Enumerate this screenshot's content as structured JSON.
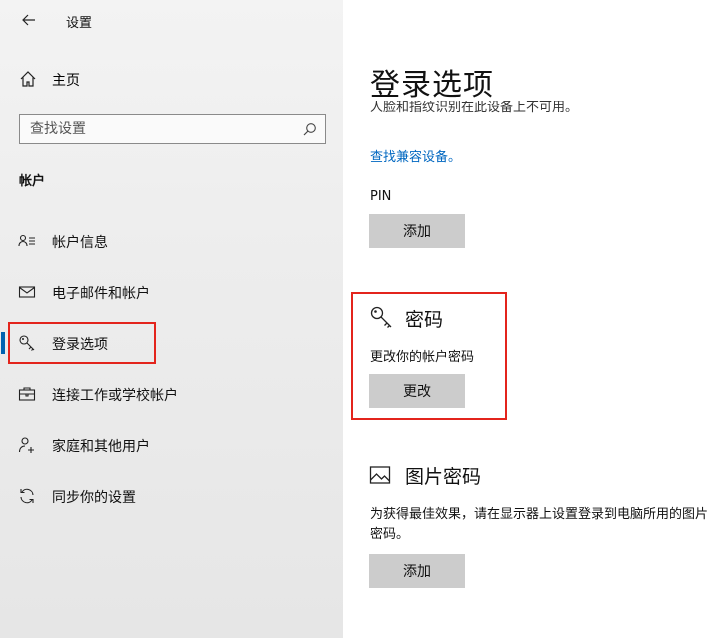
{
  "sidebar": {
    "title": "设置",
    "home_label": "主页",
    "search_placeholder": "查找设置",
    "group_heading": "帐户",
    "items": [
      {
        "label": "帐户信息",
        "icon": "user-info-icon"
      },
      {
        "label": "电子邮件和帐户",
        "icon": "mail-icon"
      },
      {
        "label": "登录选项",
        "icon": "key-icon",
        "selected": true
      },
      {
        "label": "连接工作或学校帐户",
        "icon": "briefcase-icon"
      },
      {
        "label": "家庭和其他用户",
        "icon": "add-user-icon"
      },
      {
        "label": "同步你的设置",
        "icon": "sync-icon"
      }
    ]
  },
  "main": {
    "title": "登录选项",
    "clipped_text": "人脸和指纹识别在此设备上不可用。",
    "find_link": "查找兼容设备。",
    "pin": {
      "label": "PIN",
      "button": "添加"
    },
    "password": {
      "heading": "密码",
      "description": "更改你的帐户密码",
      "button": "更改"
    },
    "picture_password": {
      "heading": "图片密码",
      "description": "为获得最佳效果，请在显示器上设置登录到电脑所用的图片密码。",
      "button": "添加"
    }
  },
  "colors": {
    "accent": "#0063b1",
    "link": "#0067c0",
    "highlight_border": "#e3241c",
    "button_bg": "#cccccc"
  }
}
